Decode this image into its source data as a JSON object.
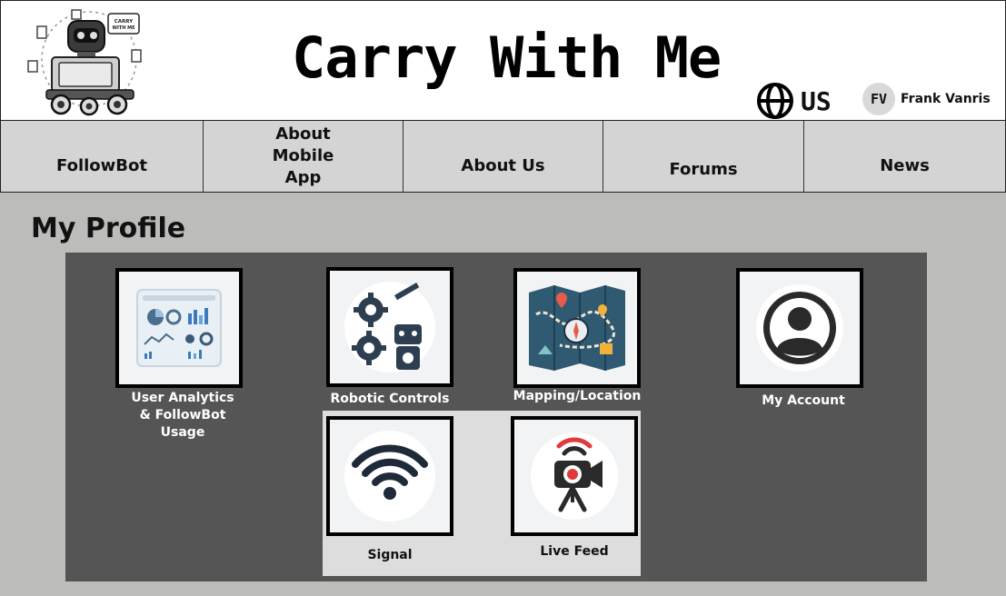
{
  "header": {
    "title": "Carry With Me",
    "logo_badge_text": "CARRY WITH ME",
    "language_label": "US",
    "user_initials": "FV",
    "user_name": "Frank Vanris"
  },
  "nav": {
    "items": [
      {
        "label": "FollowBot"
      },
      {
        "label": "About Mobile App"
      },
      {
        "label": "About Us"
      },
      {
        "label": "Forums"
      },
      {
        "label": "News"
      }
    ]
  },
  "main": {
    "page_title": "My Profile",
    "tiles": [
      {
        "label": "User Analytics & FollowBot Usage",
        "icon": "analytics-dashboard-icon"
      },
      {
        "label": "Robotic Controls",
        "icon": "robot-gears-icon"
      },
      {
        "label": "Mapping/Location",
        "icon": "map-icon"
      },
      {
        "label": "My Account",
        "icon": "account-icon"
      },
      {
        "label": "Signal",
        "icon": "signal-icon"
      },
      {
        "label": "Live Feed",
        "icon": "camera-icon"
      }
    ]
  },
  "colors": {
    "nav_bg": "#d4d4d4",
    "main_bg": "#bcbdba",
    "panel_bg": "#555555",
    "sub_panel_bg": "#dddddd"
  }
}
